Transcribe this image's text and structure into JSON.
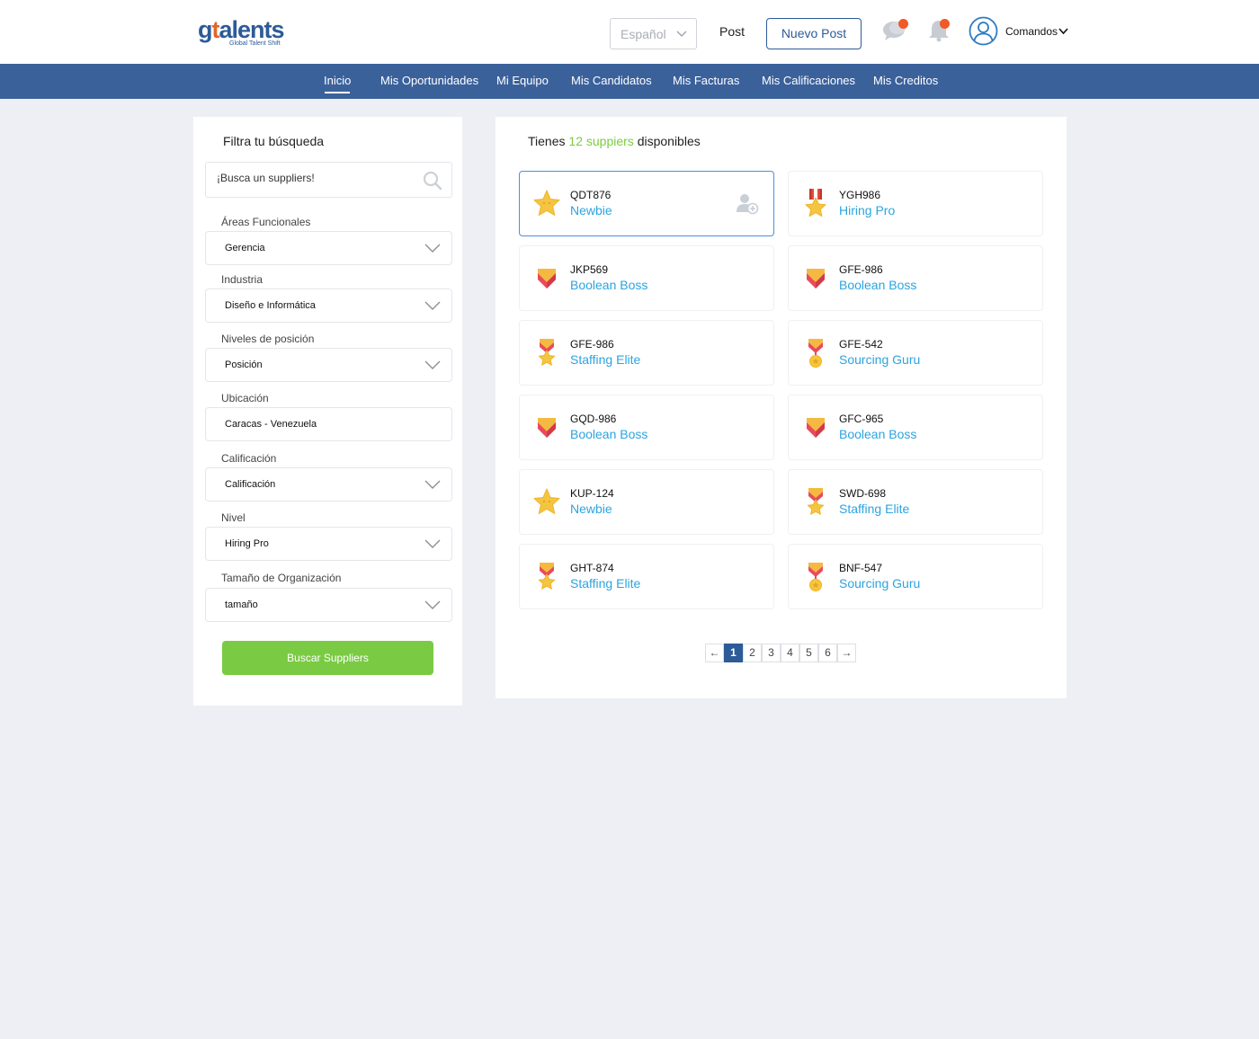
{
  "header": {
    "logo_text": "gtalents",
    "logo_tagline": "Global Talent Shift",
    "language": "Español",
    "post_link": "Post",
    "new_post_button": "Nuevo Post",
    "user_menu_label": "Comandos"
  },
  "nav": {
    "items": [
      {
        "label": "Inicio",
        "active": true
      },
      {
        "label": "Mis Oportunidades"
      },
      {
        "label": "Mi Equipo"
      },
      {
        "label": "Mis Candidatos"
      },
      {
        "label": "Mis Facturas"
      },
      {
        "label": "Mis Calificaciones"
      },
      {
        "label": "Mis Creditos"
      }
    ]
  },
  "filter": {
    "title": "Filtra tu búsqueda",
    "search_placeholder": "¡Busca un suppliers!",
    "fields": [
      {
        "label": "Áreas Funcionales",
        "value": "Gerencia",
        "dropdown": true
      },
      {
        "label": "Industria",
        "value": "Diseño e Informática",
        "dropdown": true
      },
      {
        "label": "Niveles de posición",
        "value": "Posición",
        "dropdown": true
      },
      {
        "label": "Ubicación",
        "value": "Caracas - Venezuela",
        "dropdown": false
      },
      {
        "label": "Calificación",
        "value": "Calificación",
        "dropdown": true
      },
      {
        "label": "Nivel",
        "value": "Hiring Pro",
        "dropdown": true
      },
      {
        "label": "Tamaño de Organización",
        "value": "tamaño",
        "dropdown": true
      }
    ],
    "submit_button": "Buscar Suppliers"
  },
  "results": {
    "head_prefix": "Tienes",
    "count_text": "12 suppiers",
    "head_suffix": "disponibles",
    "cards": [
      {
        "code": "QDT876",
        "level": "Newbie",
        "badge": "star-badge-icon",
        "selected": true
      },
      {
        "code": "YGH986",
        "level": "Hiring Pro",
        "badge": "ribbon-star-badge-icon"
      },
      {
        "code": "JKP569",
        "level": "Boolean Boss",
        "badge": "shield-badge-icon"
      },
      {
        "code": "GFE-986",
        "level": "Boolean Boss",
        "badge": "shield-badge-icon"
      },
      {
        "code": "GFE-986",
        "level": "Staffing Elite",
        "badge": "shield-star-badge-icon"
      },
      {
        "code": "GFE-542",
        "level": "Sourcing Guru",
        "badge": "shield-medal-badge-icon"
      },
      {
        "code": "GQD-986",
        "level": "Boolean Boss",
        "badge": "shield-badge-icon"
      },
      {
        "code": "GFC-965",
        "level": "Boolean Boss",
        "badge": "shield-badge-icon"
      },
      {
        "code": "KUP-124",
        "level": "Newbie",
        "badge": "star-badge-icon"
      },
      {
        "code": "SWD-698",
        "level": "Staffing Elite",
        "badge": "shield-star-badge-icon"
      },
      {
        "code": "GHT-874",
        "level": "Staffing Elite",
        "badge": "shield-star-badge-icon"
      },
      {
        "code": "BNF-547",
        "level": "Sourcing Guru",
        "badge": "shield-medal-badge-icon"
      }
    ]
  },
  "pagination": {
    "prev": "←",
    "pages": [
      "1",
      "2",
      "3",
      "4",
      "5",
      "6"
    ],
    "current": "1",
    "next": "→"
  },
  "colors": {
    "nav_bg": "#3b619b",
    "accent_green": "#7acb43",
    "level_blue": "#2ba4e0",
    "brand_blue": "#2d5b98",
    "notification": "#f05a28"
  }
}
